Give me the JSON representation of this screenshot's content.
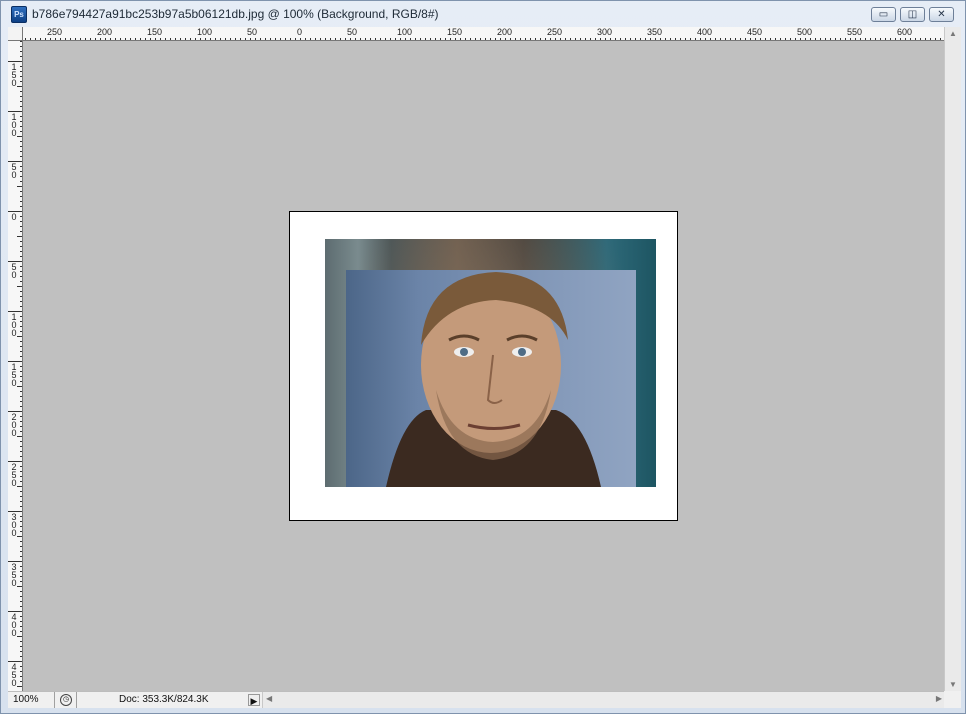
{
  "window": {
    "title": "b786e794427a91bc253b97a5b06121db.jpg @ 100% (Background, RGB/8#)",
    "app_icon": "Ps",
    "controls": {
      "minimize": "▭",
      "restore": "◫",
      "close": "✕"
    }
  },
  "ruler_h": {
    "labels": [
      "250",
      "200",
      "150",
      "100",
      "50",
      "0",
      "50",
      "100",
      "150",
      "200",
      "250",
      "300",
      "350",
      "400",
      "450",
      "500",
      "550",
      "600",
      "6"
    ]
  },
  "ruler_v": {
    "labels": [
      "150",
      "100",
      "50",
      "0",
      "50",
      "100",
      "150",
      "200",
      "250",
      "300",
      "350",
      "400",
      "450"
    ]
  },
  "statusbar": {
    "zoom": "100%",
    "doc_info": "Doc: 353.3K/824.3K",
    "arrow": "▶"
  },
  "colors": {
    "canvas": "#c0c0c0",
    "titlebar": "#dfe6ee"
  },
  "icons": {
    "app": "photoshop-icon",
    "status": "status-menu-icon"
  }
}
